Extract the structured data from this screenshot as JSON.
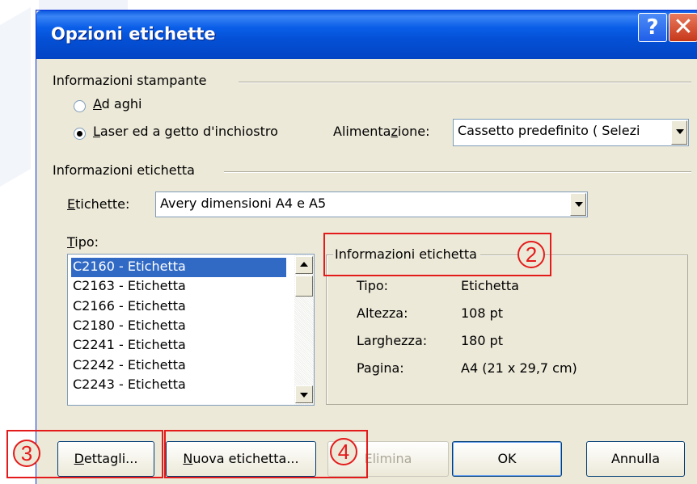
{
  "dialog": {
    "title": "Opzioni etichette",
    "help_glyph": "?",
    "close_glyph": "✕"
  },
  "printer_info": {
    "group_label": "Informazioni stampante",
    "dot_matrix": {
      "prefix": "",
      "key": "A",
      "rest": "d aghi",
      "checked": false
    },
    "laser": {
      "key": "L",
      "rest": "aser ed a getto d'inchiostro",
      "checked": true
    },
    "tray_label_pre": "Alimenta",
    "tray_label_key": "z",
    "tray_label_post": "ione:",
    "tray_value": "Cassetto predefinito ( Selezi"
  },
  "label_info": {
    "group_label": "Informazioni etichetta",
    "vendor_label_key": "E",
    "vendor_label_rest": "tichette:",
    "vendor_value": "Avery dimensioni A4 e A5",
    "type_label_key": "T",
    "type_label_rest": "ipo:",
    "type_items": [
      "C2160 - Etichetta",
      "C2163 - Etichetta",
      "C2166 - Etichetta",
      "C2180 - Etichetta",
      "C2241 - Etichetta",
      "C2242 - Etichetta",
      "C2243 - Etichetta"
    ],
    "selected_index": 0
  },
  "details_box": {
    "title": "Informazioni etichetta",
    "rows": [
      {
        "label": "Tipo:",
        "value": "Etichetta"
      },
      {
        "label": "Altezza:",
        "value": "108 pt"
      },
      {
        "label": "Larghezza:",
        "value": "180 pt"
      },
      {
        "label": "Pagina:",
        "value": "A4 (21 x 29,7 cm)"
      }
    ]
  },
  "buttons": {
    "details_key": "D",
    "details_rest": "ettagli...",
    "new_key": "N",
    "new_rest": "uova etichetta...",
    "delete": "Elimina",
    "ok": "OK",
    "cancel": "Annulla"
  },
  "callouts": {
    "c2": "2",
    "c3": "3",
    "c4": "4"
  },
  "colors": {
    "callout_red": "#e41b1b",
    "selection_blue": "#316ac5",
    "title_blue": "#0450d5"
  }
}
